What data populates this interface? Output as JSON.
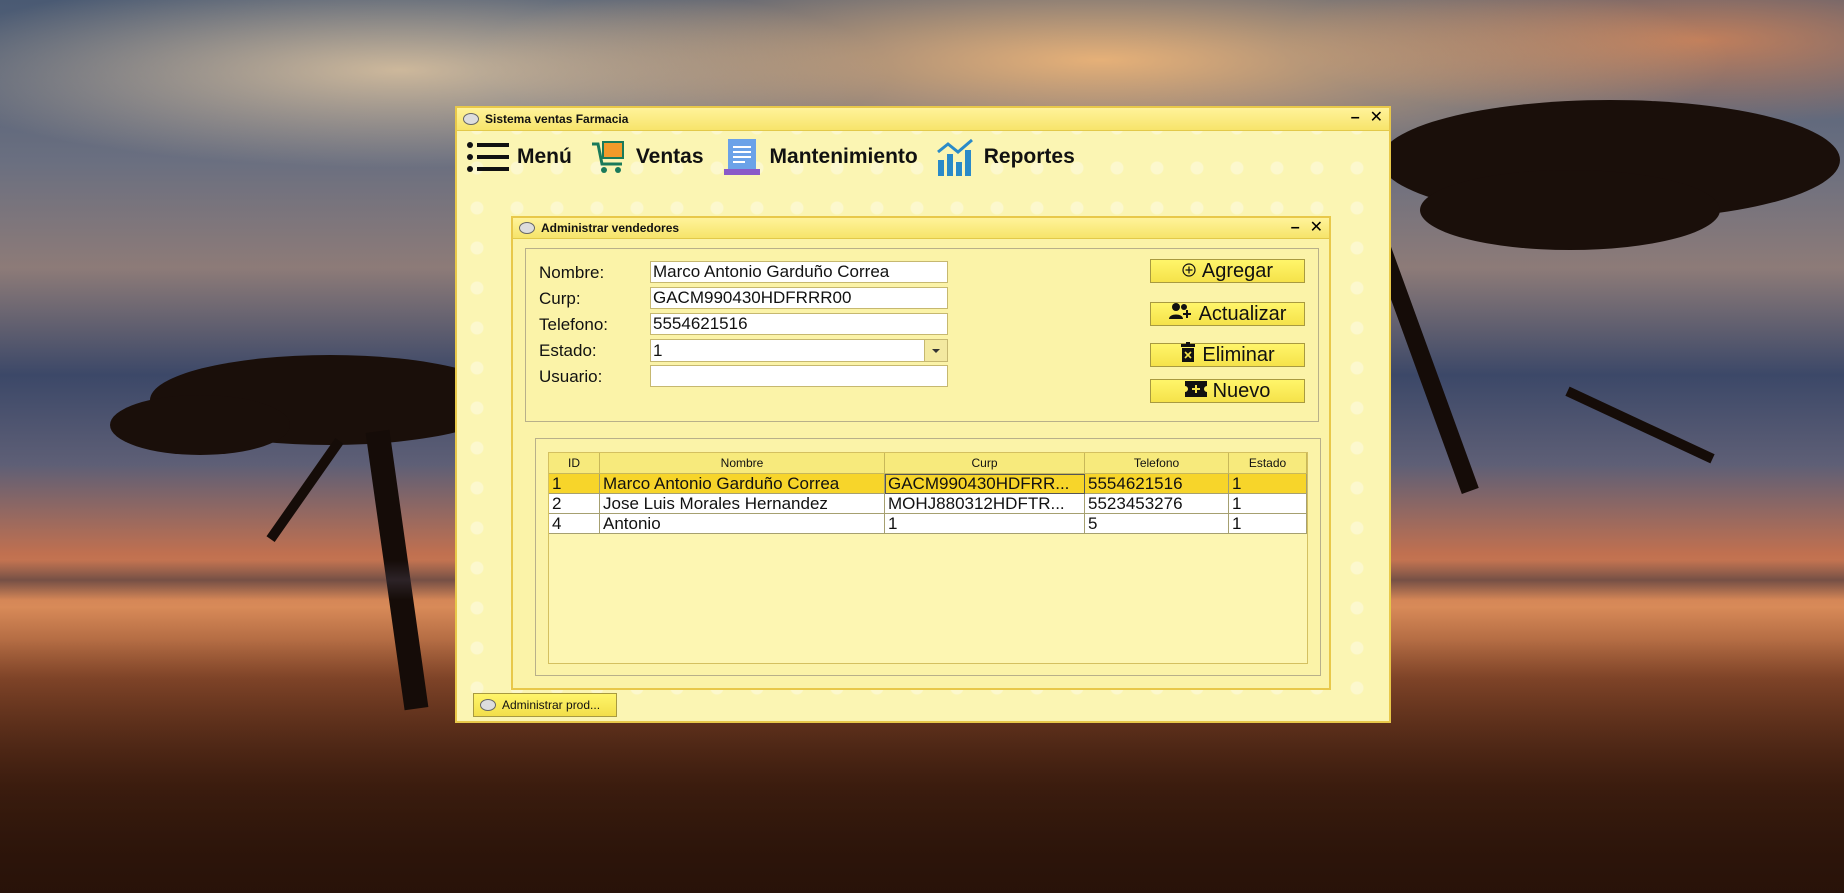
{
  "app": {
    "title": "Sistema ventas Farmacia",
    "minimize_label": "–",
    "close_label": "✕"
  },
  "menu": [
    {
      "label": "Menú",
      "icon": "hamburger-icon"
    },
    {
      "label": "Ventas",
      "icon": "shopping-cart-icon"
    },
    {
      "label": "Mantenimiento",
      "icon": "receipt-icon"
    },
    {
      "label": "Reportes",
      "icon": "bar-chart-icon"
    }
  ],
  "dialog": {
    "title": "Administrar vendedores",
    "minimize_label": "–",
    "close_label": "✕"
  },
  "form": {
    "nombre_label": "Nombre:",
    "nombre_value": "Marco Antonio Garduño Correa",
    "curp_label": "Curp:",
    "curp_value": "GACM990430HDFRRR00",
    "telefono_label": "Telefono:",
    "telefono_value": "5554621516",
    "estado_label": "Estado:",
    "estado_value": "1",
    "usuario_label": "Usuario:",
    "usuario_value": ""
  },
  "buttons": {
    "agregar": "Agregar",
    "actualizar": "Actualizar",
    "eliminar": "Eliminar",
    "nuevo": "Nuevo"
  },
  "table": {
    "columns": [
      "ID",
      "Nombre",
      "Curp",
      "Telefono",
      "Estado"
    ],
    "rows": [
      [
        "1",
        "Marco Antonio Garduño Correa",
        "GACM990430HDFRR...",
        "5554621516",
        "1"
      ],
      [
        "2",
        "Jose Luis Morales Hernandez",
        "MOHJ880312HDFTR...",
        "5523453276",
        "1"
      ],
      [
        "4",
        "Antonio",
        "1",
        "5",
        "1"
      ]
    ],
    "selected_row": 0
  },
  "taskbar": {
    "item_label": "Administrar prod..."
  },
  "colors": {
    "window_bg": "#fbf5b3",
    "title_bar": "#f7e46b",
    "selected_row": "#f7d52a",
    "button_bg": "#f5e24a"
  }
}
